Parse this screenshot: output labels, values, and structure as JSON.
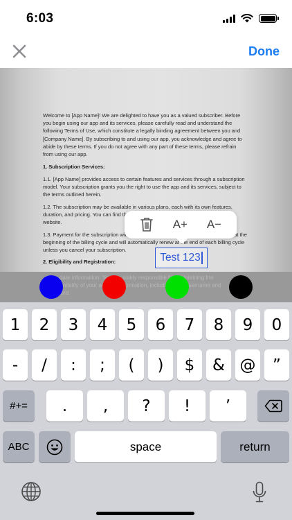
{
  "status_bar": {
    "time": "6:03"
  },
  "nav": {
    "done_label": "Done",
    "close_icon": "close-x-icon"
  },
  "document": {
    "paragraphs": [
      {
        "text": "Welcome to [App Name]! We are delighted to have you as a valued subscriber. Before you begin using our app and its services, please carefully read and understand the following Terms of Use, which constitute a legally binding agreement between you and [Company Name]. By subscribing to and using our app, you acknowledge and agree to abide by these terms. If you do not agree with any part of these terms, please refrain from using our app.",
        "heading": false
      },
      {
        "text": "1. Subscription Services:",
        "heading": true
      },
      {
        "text": "1.1. [App Name] provides access to certain features and services through a subscription model. Your subscription grants you the right to use the app and its services, subject to the terms outlined herein.",
        "heading": false
      },
      {
        "text": "1.2. The subscription may be available in various plans, each with its own features, duration, and pricing. You can find the details of each plan within the app or on our website.",
        "heading": false
      },
      {
        "text": "1.3. Payment for the subscription will be charged to your selected payment method at the beginning of the billing cycle and will automatically renew at the end of each billing cycle unless you cancel your subscription.",
        "heading": false
      },
      {
        "text": "2. Eligibility and Registration:",
        "heading": true
      }
    ],
    "strip_lines": [
      "up-to-date information. You are solely responsible for maintaining the",
      "confidentiality of your account information, including your username and",
      "password."
    ]
  },
  "edit_popup": {
    "increase_label": "A+",
    "decrease_label": "A−",
    "delete_icon": "trash-icon"
  },
  "text_box": {
    "value": "Test 123"
  },
  "colors": [
    "#0a00f0",
    "#f20000",
    "#00e000",
    "#000000"
  ],
  "keyboard": {
    "row1": [
      "1",
      "2",
      "3",
      "4",
      "5",
      "6",
      "7",
      "8",
      "9",
      "0"
    ],
    "row2": [
      "-",
      "/",
      ":",
      ";",
      "(",
      ")",
      "$",
      "&",
      "@",
      "”"
    ],
    "row3_left": "#+=",
    "row3": [
      ".",
      ",",
      "?",
      "!",
      "’"
    ],
    "abc": "ABC",
    "space": "space",
    "return": "return"
  }
}
